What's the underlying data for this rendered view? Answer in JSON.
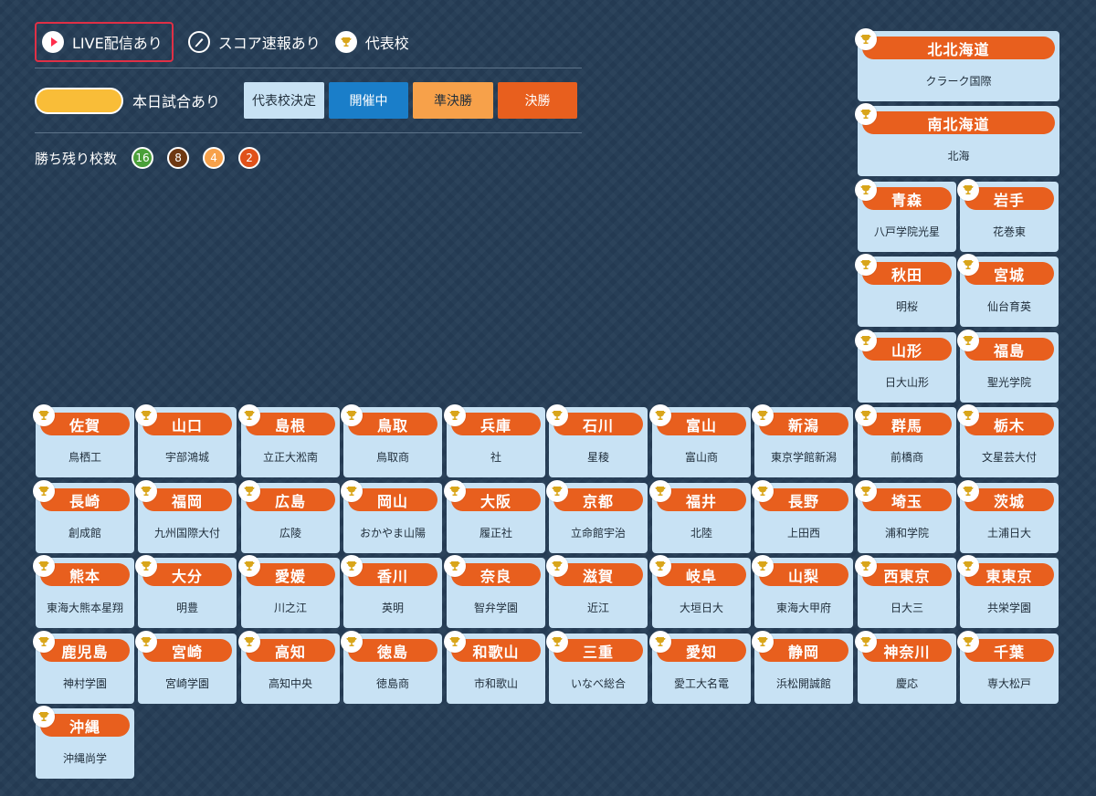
{
  "legend": {
    "live_label": "LIVE配信あり",
    "score_label": "スコア速報あり",
    "rep_label": "代表校",
    "today_label": "本日試合あり",
    "states": [
      {
        "label": "代表校決定",
        "bg": "#c8e2f4",
        "fg": "#1f2d3a"
      },
      {
        "label": "開催中",
        "bg": "#1a7ec9",
        "fg": "#ffffff"
      },
      {
        "label": "準決勝",
        "bg": "#f7a14a",
        "fg": "#1f2d3a"
      },
      {
        "label": "決勝",
        "bg": "#e85f1e",
        "fg": "#ffffff"
      }
    ],
    "remain_label": "勝ち残り校数",
    "remain_counts": [
      {
        "value": "16",
        "color": "#4aa039"
      },
      {
        "value": "8",
        "color": "#6e3812"
      },
      {
        "value": "4",
        "color": "#f7a14a"
      },
      {
        "value": "2",
        "color": "#e0511a"
      }
    ]
  },
  "colors": {
    "accent": "#e85f1e",
    "tile_bg": "#c8e2f4",
    "page_bg": "#253c55",
    "trophy": "#d9a51a"
  },
  "prefectures": [
    {
      "name": "北北海道",
      "school": "クラーク国際"
    },
    {
      "name": "南北海道",
      "school": "北海"
    },
    {
      "name": "青森",
      "school": "八戸学院光星"
    },
    {
      "name": "岩手",
      "school": "花巻東"
    },
    {
      "name": "秋田",
      "school": "明桜"
    },
    {
      "name": "宮城",
      "school": "仙台育英"
    },
    {
      "name": "山形",
      "school": "日大山形"
    },
    {
      "name": "福島",
      "school": "聖光学院"
    },
    {
      "name": "佐賀",
      "school": "鳥栖工"
    },
    {
      "name": "山口",
      "school": "宇部鴻城"
    },
    {
      "name": "島根",
      "school": "立正大淞南"
    },
    {
      "name": "鳥取",
      "school": "鳥取商"
    },
    {
      "name": "兵庫",
      "school": "社"
    },
    {
      "name": "石川",
      "school": "星稜"
    },
    {
      "name": "富山",
      "school": "富山商"
    },
    {
      "name": "新潟",
      "school": "東京学館新潟"
    },
    {
      "name": "群馬",
      "school": "前橋商"
    },
    {
      "name": "栃木",
      "school": "文星芸大付"
    },
    {
      "name": "長崎",
      "school": "創成館"
    },
    {
      "name": "福岡",
      "school": "九州国際大付"
    },
    {
      "name": "広島",
      "school": "広陵"
    },
    {
      "name": "岡山",
      "school": "おかやま山陽"
    },
    {
      "name": "大阪",
      "school": "履正社"
    },
    {
      "name": "京都",
      "school": "立命館宇治"
    },
    {
      "name": "福井",
      "school": "北陸"
    },
    {
      "name": "長野",
      "school": "上田西"
    },
    {
      "name": "埼玉",
      "school": "浦和学院"
    },
    {
      "name": "茨城",
      "school": "土浦日大"
    },
    {
      "name": "熊本",
      "school": "東海大熊本星翔"
    },
    {
      "name": "大分",
      "school": "明豊"
    },
    {
      "name": "愛媛",
      "school": "川之江"
    },
    {
      "name": "香川",
      "school": "英明"
    },
    {
      "name": "奈良",
      "school": "智弁学園"
    },
    {
      "name": "滋賀",
      "school": "近江"
    },
    {
      "name": "岐阜",
      "school": "大垣日大"
    },
    {
      "name": "山梨",
      "school": "東海大甲府"
    },
    {
      "name": "西東京",
      "school": "日大三"
    },
    {
      "name": "東東京",
      "school": "共栄学園"
    },
    {
      "name": "鹿児島",
      "school": "神村学園"
    },
    {
      "name": "宮崎",
      "school": "宮崎学園"
    },
    {
      "name": "高知",
      "school": "高知中央"
    },
    {
      "name": "徳島",
      "school": "徳島商"
    },
    {
      "name": "和歌山",
      "school": "市和歌山"
    },
    {
      "name": "三重",
      "school": "いなべ総合"
    },
    {
      "name": "愛知",
      "school": "愛工大名電"
    },
    {
      "name": "静岡",
      "school": "浜松開誠館"
    },
    {
      "name": "神奈川",
      "school": "慶応"
    },
    {
      "name": "千葉",
      "school": "専大松戸"
    },
    {
      "name": "沖縄",
      "school": "沖縄尚学"
    }
  ]
}
